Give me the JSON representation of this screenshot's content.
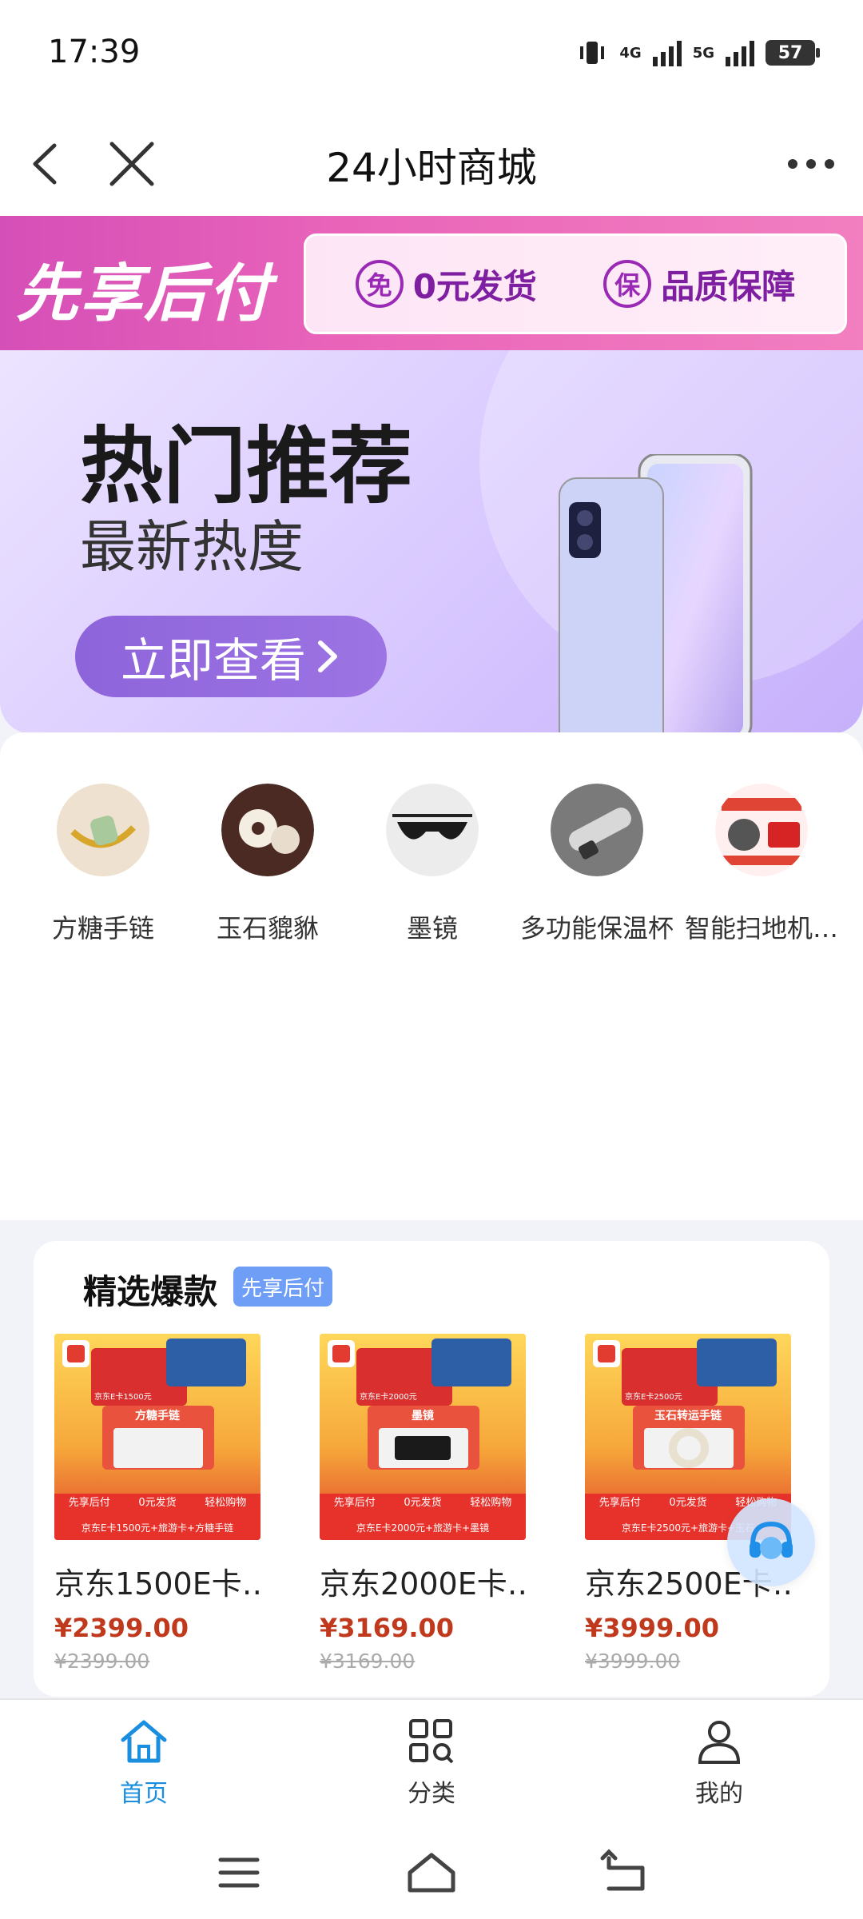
{
  "status": {
    "time": "17:39",
    "battery": "57",
    "network_1": "4G",
    "network_2": "5G"
  },
  "nav": {
    "title": "24小时商城"
  },
  "promo": {
    "title": "先享后付",
    "item1_circle": "免",
    "item1_text": "0元发货",
    "item2_circle": "保",
    "item2_text": "品质保障"
  },
  "hero": {
    "title": "热门推荐",
    "subtitle": "最新热度",
    "button": "立即查看"
  },
  "categories": [
    {
      "label": "方糖手链",
      "icon": "bracelet-icon"
    },
    {
      "label": "玉石貔貅",
      "icon": "jade-icon"
    },
    {
      "label": "墨镜",
      "icon": "sunglasses-icon"
    },
    {
      "label": "多功能保温杯",
      "icon": "thermos-icon"
    },
    {
      "label": "智能扫地机…",
      "icon": "robot-vacuum-icon"
    }
  ],
  "selected": {
    "title": "精选爆款",
    "badge": "先享后付",
    "products": [
      {
        "name": "京东1500E卡…",
        "price": "¥2399.00",
        "old_price": "¥2399.00",
        "tag": "方糖手链",
        "card": "京东E卡1500元",
        "footer": "京东E卡1500元+旅游卡+方糖手链"
      },
      {
        "name": "京东2000E卡…",
        "price": "¥3169.00",
        "old_price": "¥3169.00",
        "tag": "墨镜",
        "card": "京东E卡2000元",
        "footer": "京东E卡2000元+旅游卡+墨镜"
      },
      {
        "name": "京东2500E卡…",
        "price": "¥3999.00",
        "old_price": "¥3999.00",
        "tag": "玉石转运手链",
        "card": "京东E卡2500元",
        "footer": "京东E卡2500元+旅游卡+玉石"
      }
    ],
    "product_strip": [
      "先享后付",
      "0元发货",
      "轻松购物"
    ]
  },
  "tabs": [
    {
      "label": "首页",
      "active": true
    },
    {
      "label": "分类",
      "active": false
    },
    {
      "label": "我的",
      "active": false
    }
  ],
  "colors": {
    "accent": "#1a8fe0",
    "price": "#c0391d",
    "promo": "#d54fb8",
    "hero_button": "#8e64db"
  }
}
